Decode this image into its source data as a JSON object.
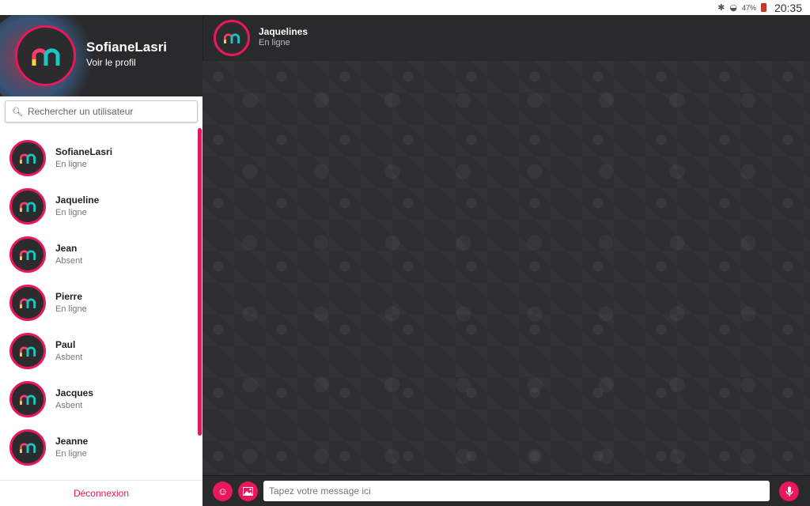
{
  "status_bar": {
    "battery": "47%",
    "time": "20:35"
  },
  "profile": {
    "name": "SofianeLasri",
    "link": "Voir le profil"
  },
  "search": {
    "placeholder": "Rechercher un utilisateur"
  },
  "users": [
    {
      "name": "SofianeLasri",
      "status": "En ligne"
    },
    {
      "name": "Jaqueline",
      "status": "En ligne"
    },
    {
      "name": "Jean",
      "status": "Absent"
    },
    {
      "name": "Pierre",
      "status": "En ligne"
    },
    {
      "name": "Paul",
      "status": "Asbent"
    },
    {
      "name": "Jacques",
      "status": "Asbent"
    },
    {
      "name": "Jeanne",
      "status": "En ligne"
    }
  ],
  "logout_label": "Déconnexion",
  "chat": {
    "name": "Jaquelines",
    "status": "En ligne"
  },
  "composer": {
    "placeholder": "Tapez votre message ici"
  },
  "colors": {
    "accent": "#e8185a",
    "dark": "#2a2a2c"
  },
  "icons": {
    "status_bar": [
      "bluetooth-icon",
      "wifi-icon",
      "battery-icon"
    ],
    "search": "search-icon",
    "composer": [
      "emoji-icon",
      "image-icon",
      "microphone-icon"
    ]
  }
}
